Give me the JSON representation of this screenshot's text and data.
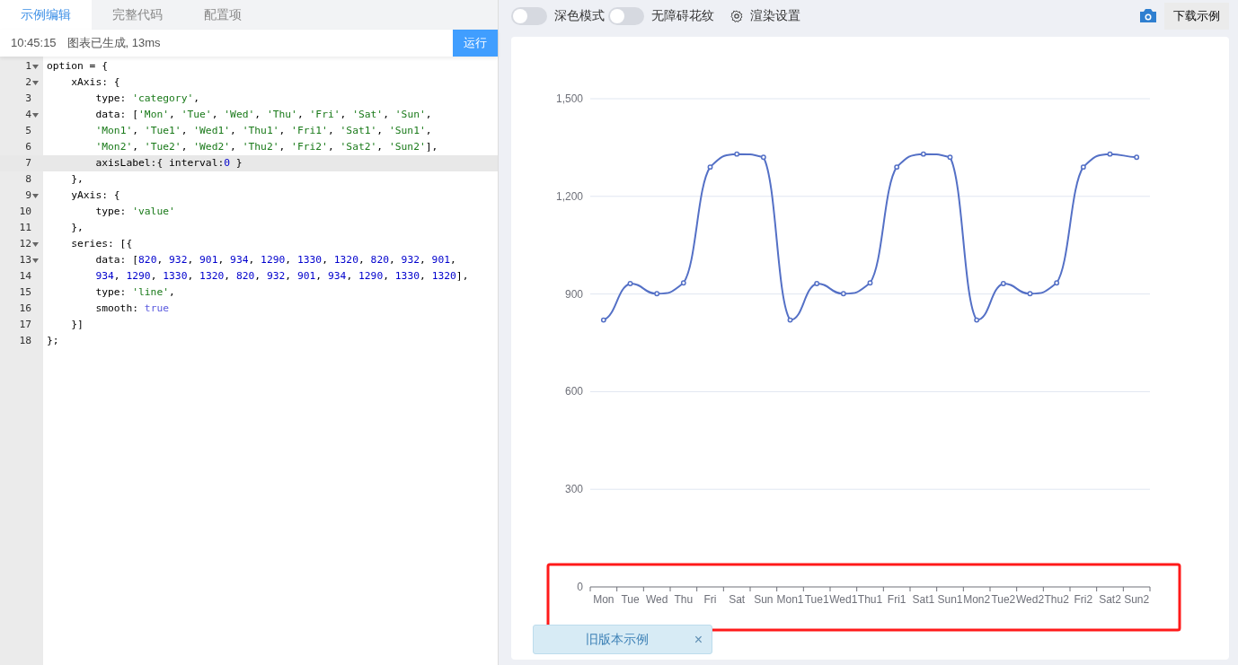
{
  "editor_tabs": [
    {
      "label": "示例编辑",
      "selected": true
    },
    {
      "label": "完整代码",
      "selected": false
    },
    {
      "label": "配置项",
      "selected": false
    }
  ],
  "status_bar": {
    "time": "10:45:15",
    "message": "图表已生成, 13ms",
    "run_button": "运行"
  },
  "code": {
    "lines": [
      {
        "number": "1",
        "text": "option = {",
        "foldable": true,
        "current": false
      },
      {
        "number": "2",
        "text": "    xAxis: {",
        "foldable": true,
        "current": false
      },
      {
        "number": "3",
        "text": "        type: 'category',",
        "foldable": false,
        "current": false
      },
      {
        "number": "4",
        "text": "        data: ['Mon', 'Tue', 'Wed', 'Thu', 'Fri', 'Sat', 'Sun',",
        "foldable": true,
        "current": false
      },
      {
        "number": "5",
        "text": "        'Mon1', 'Tue1', 'Wed1', 'Thu1', 'Fri1', 'Sat1', 'Sun1',",
        "foldable": false,
        "current": false
      },
      {
        "number": "6",
        "text": "        'Mon2', 'Tue2', 'Wed2', 'Thu2', 'Fri2', 'Sat2', 'Sun2'],",
        "foldable": false,
        "current": false
      },
      {
        "number": "7",
        "text": "        axisLabel:{ interval:0 }",
        "foldable": false,
        "current": true
      },
      {
        "number": "8",
        "text": "    },",
        "foldable": false,
        "current": false
      },
      {
        "number": "9",
        "text": "    yAxis: {",
        "foldable": true,
        "current": false
      },
      {
        "number": "10",
        "text": "        type: 'value'",
        "foldable": false,
        "current": false
      },
      {
        "number": "11",
        "text": "    },",
        "foldable": false,
        "current": false
      },
      {
        "number": "12",
        "text": "    series: [{",
        "foldable": true,
        "current": false
      },
      {
        "number": "13",
        "text": "        data: [820, 932, 901, 934, 1290, 1330, 1320, 820, 932, 901,",
        "foldable": true,
        "current": false
      },
      {
        "number": "14",
        "text": "        934, 1290, 1330, 1320, 820, 932, 901, 934, 1290, 1330, 1320],",
        "foldable": false,
        "current": false
      },
      {
        "number": "15",
        "text": "        type: 'line',",
        "foldable": false,
        "current": false
      },
      {
        "number": "16",
        "text": "        smooth: true",
        "foldable": false,
        "current": false
      },
      {
        "number": "17",
        "text": "    }]",
        "foldable": false,
        "current": false
      },
      {
        "number": "18",
        "text": "};",
        "foldable": false,
        "current": false
      }
    ]
  },
  "toolbar": {
    "toggles": [
      {
        "label": "深色模式",
        "on": false
      },
      {
        "label": "无障碍花纹",
        "on": false
      }
    ],
    "render_settings": "渲染设置",
    "download_button": "下载示例"
  },
  "chart": {
    "chart_data": {
      "type": "line",
      "categories": [
        "Mon",
        "Tue",
        "Wed",
        "Thu",
        "Fri",
        "Sat",
        "Sun",
        "Mon1",
        "Tue1",
        "Wed1",
        "Thu1",
        "Fri1",
        "Sat1",
        "Sun1",
        "Mon2",
        "Tue2",
        "Wed2",
        "Thu2",
        "Fri2",
        "Sat2",
        "Sun2"
      ],
      "grid": true,
      "series": [
        {
          "color": "#5470c6",
          "marker": "circle",
          "values": [
            820,
            932,
            901,
            934,
            1290,
            1330,
            1320,
            820,
            932,
            901,
            934,
            1290,
            1330,
            1320,
            820,
            932,
            901,
            934,
            1290,
            1330,
            1320
          ]
        }
      ],
      "ylim": [
        0,
        1500
      ],
      "yticks": [
        {
          "value": 0,
          "label": "0"
        },
        {
          "value": 300,
          "label": "300"
        },
        {
          "value": 600,
          "label": "600"
        },
        {
          "value": 900,
          "label": "900"
        },
        {
          "value": 1200,
          "label": "1,200"
        },
        {
          "value": 1500,
          "label": "1,500"
        }
      ]
    },
    "highlight_frame": {
      "shown": true
    }
  },
  "notice": {
    "text": "旧版本示例",
    "close": "×"
  }
}
